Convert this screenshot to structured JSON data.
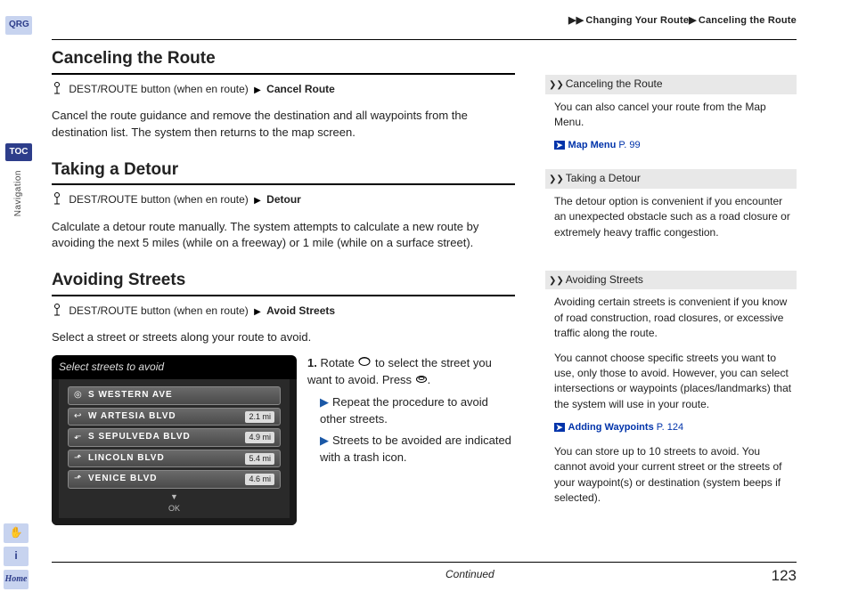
{
  "breadcrumb": {
    "bullets": "▶▶",
    "a": "Changing Your Route",
    "sep": "▶",
    "b": "Canceling the Route"
  },
  "side": {
    "qrg": "QRG",
    "toc": "TOC",
    "section": "Navigation",
    "home": "Home"
  },
  "main": {
    "s1": {
      "title": "Canceling the Route",
      "crumb_pre": "DEST/ROUTE button (when en route)",
      "crumb_bold": "Cancel Route",
      "body": "Cancel the route guidance and remove the destination and all waypoints from the destination list. The system then returns to the map screen."
    },
    "s2": {
      "title": "Taking a Detour",
      "crumb_pre": "DEST/ROUTE button (when en route)",
      "crumb_bold": "Detour",
      "body": "Calculate a detour route manually. The system attempts to calculate a new route by avoiding the next 5 miles (while on a freeway) or 1 mile (while on a surface street)."
    },
    "s3": {
      "title": "Avoiding Streets",
      "crumb_pre": "DEST/ROUTE button (when en route)",
      "crumb_bold": "Avoid Streets",
      "body": "Select a street or streets along your route to avoid.",
      "screenshot_title": "Select streets to avoid",
      "rows": [
        {
          "icon": "◎",
          "name": "S WESTERN AVE",
          "dist": ""
        },
        {
          "icon": "↩",
          "name": "W ARTESIA BLVD",
          "dist": "2.1 mi"
        },
        {
          "icon": "⬐",
          "name": "S SEPULVEDA BLVD",
          "dist": "4.9 mi"
        },
        {
          "icon": "⬏",
          "name": "LINCOLN BLVD",
          "dist": "5.4 mi"
        },
        {
          "icon": "⬏",
          "name": "VENICE BLVD",
          "dist": "4.6 mi"
        }
      ],
      "ok": "OK",
      "step_num": "1.",
      "step_a": "Rotate ",
      "step_b": " to select the street you want to avoid. Press ",
      "step_c": ".",
      "sub1": "Repeat the procedure to avoid other streets.",
      "sub2": "Streets to be avoided are indicated with a trash icon."
    }
  },
  "info": {
    "b1": {
      "head": "Canceling the Route",
      "p1": "You can also cancel your route from the Map Menu.",
      "xref": "Map Menu",
      "pg": "P. 99"
    },
    "b2": {
      "head": "Taking a Detour",
      "p1": "The detour option is convenient if you encounter an unexpected obstacle such as a road closure or extremely heavy traffic congestion."
    },
    "b3": {
      "head": "Avoiding Streets",
      "p1": "Avoiding certain streets is convenient if you know of road construction, road closures, or excessive traffic along the route.",
      "p2": "You cannot choose specific streets you want to use, only those to avoid. However, you can select intersections or waypoints (places/landmarks) that the system will use in your route.",
      "xref": "Adding Waypoints",
      "pg": "P. 124",
      "p3": "You can store up to 10 streets to avoid. You cannot avoid your current street or the streets of your waypoint(s) or destination (system beeps if selected)."
    }
  },
  "footer": {
    "continued": "Continued",
    "page": "123"
  }
}
